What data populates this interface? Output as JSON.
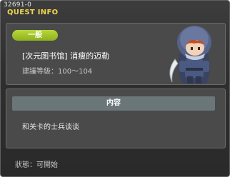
{
  "window": {
    "quest_id": "32691-0",
    "title": "QUEST INFO"
  },
  "quest": {
    "badge": "一般",
    "name": "[次元图书馆] 消瘦的迈勒",
    "level": "建議等級：100〜104"
  },
  "content": {
    "header": "内容",
    "text": "和关卡的士兵谈谈"
  },
  "status": {
    "text": "狀態：可開始"
  },
  "colors": {
    "title": "#f0d84a",
    "badge": "#9cc22a",
    "panel": "#4a4a4a",
    "header": "#6b7678"
  },
  "icons": {
    "npc": "hooded-ninja-npc-icon"
  }
}
